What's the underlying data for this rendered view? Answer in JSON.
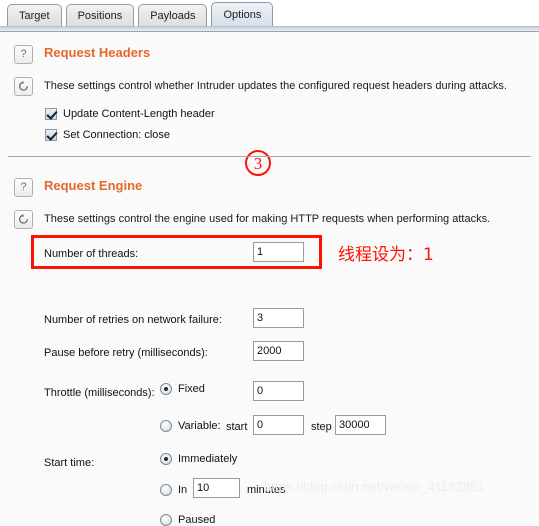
{
  "window": {
    "tabs": [
      {
        "label": "Target",
        "active": false
      },
      {
        "label": "Positions",
        "active": false
      },
      {
        "label": "Payloads",
        "active": false
      },
      {
        "label": "Options",
        "active": true
      }
    ]
  },
  "request_headers": {
    "title": "Request Headers",
    "description": "These settings control whether Intruder updates the configured request headers during attacks.",
    "help_icon": "?",
    "reset_icon": "refresh-icon",
    "checkboxes": [
      {
        "label": "Update Content-Length header",
        "checked": true
      },
      {
        "label": "Set Connection: close",
        "checked": true
      }
    ]
  },
  "request_engine": {
    "title": "Request Engine",
    "description": "These settings control the engine used for making HTTP requests when performing attacks.",
    "help_icon": "?",
    "reset_icon": "refresh-icon",
    "threads": {
      "label": "Number of threads:",
      "value": "1"
    },
    "retries": {
      "label": "Number of retries on network failure:",
      "value": "3"
    },
    "pause": {
      "label": "Pause before retry (milliseconds):",
      "value": "2000"
    },
    "throttle": {
      "label": "Throttle (milliseconds):",
      "fixed": {
        "label": "Fixed",
        "value": "0",
        "selected": true
      },
      "variable": {
        "label": "Variable:",
        "start_label": "start",
        "start_value": "0",
        "step_label": "step",
        "step_value": "30000",
        "selected": false
      }
    },
    "start_time": {
      "label": "Start time:",
      "options": [
        {
          "label": "Immediately",
          "selected": true
        },
        {
          "label": "In",
          "value": "10",
          "suffix": "minutes",
          "selected": false
        },
        {
          "label": "Paused",
          "selected": false
        }
      ]
    }
  },
  "annotations": {
    "step_marker": "3",
    "threads_note": "线程设为：1",
    "highlight_color": "#ff1200",
    "accent_color": "#e8672a"
  },
  "watermark": {
    "text": "https://blog.csdn.net/weixin_41182861"
  }
}
